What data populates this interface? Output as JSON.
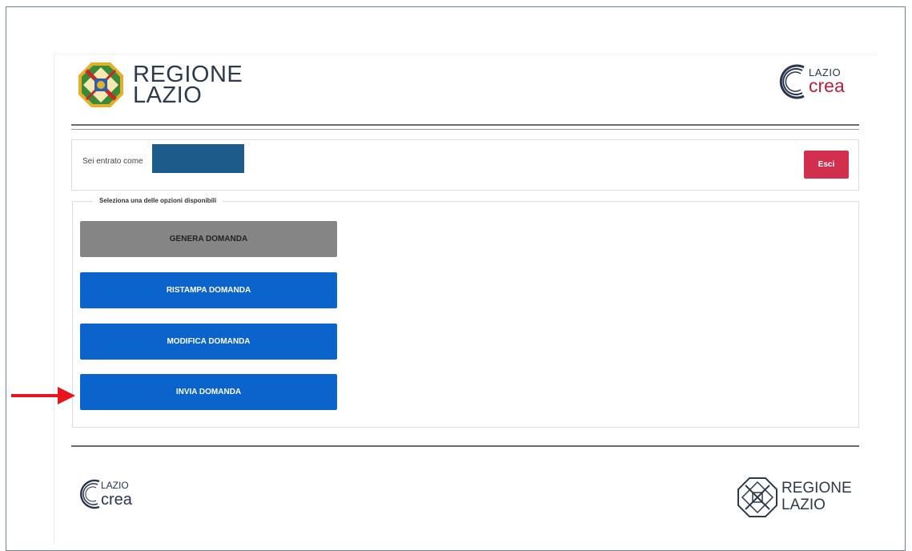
{
  "header": {
    "left_logo": {
      "line1": "REGIONE",
      "line2": "LAZIO",
      "icon": "regione-lazio-crest-icon"
    },
    "right_logo": {
      "line1": "LAZIO",
      "line2": "crea",
      "icon": "laziocrea-c-icon"
    }
  },
  "user_bar": {
    "label": "Sei entrato come",
    "logout_label": "Esci",
    "colors": {
      "logout": "#d22f4f",
      "redaction": "#1d5c8a"
    }
  },
  "options": {
    "legend": "Seleziona una delle opzioni disponibili",
    "buttons": [
      {
        "label": "GENERA DOMANDA",
        "state": "disabled"
      },
      {
        "label": "RISTAMPA DOMANDA",
        "state": "enabled"
      },
      {
        "label": "MODIFICA DOMANDA",
        "state": "enabled"
      },
      {
        "label": "INVIA DOMANDA",
        "state": "enabled",
        "highlighted": true
      }
    ],
    "colors": {
      "enabled": "#0a64cc",
      "disabled": "#858585",
      "annotation_arrow": "#e8151b"
    }
  },
  "footer": {
    "left_logo": {
      "line1": "LAZIO",
      "line2": "crea",
      "icon": "laziocrea-c-icon"
    },
    "right_logo": {
      "line1": "REGIONE",
      "line2": "LAZIO",
      "icon": "regione-lazio-crest-icon"
    }
  }
}
